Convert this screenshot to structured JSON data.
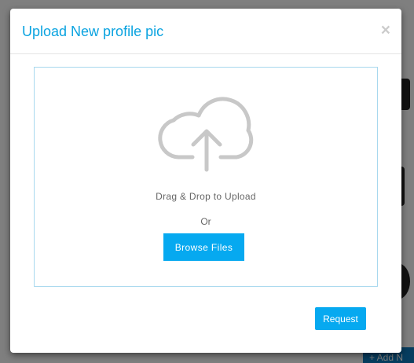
{
  "modal": {
    "title": "Upload New profile pic",
    "close_label": "×",
    "drop_text": "Drag & Drop to Upload",
    "or_text": "Or",
    "browse_label": "Browse Files",
    "request_label": "Request",
    "upload_icon": "cloud-upload-icon"
  },
  "background": {
    "add_button_label": "+ Add N"
  },
  "colors": {
    "accent": "#06a9f0",
    "title": "#0aa3e0",
    "drop_zone_border": "#a8d8ee",
    "overlay": "rgba(0,0,0,0.5)"
  }
}
